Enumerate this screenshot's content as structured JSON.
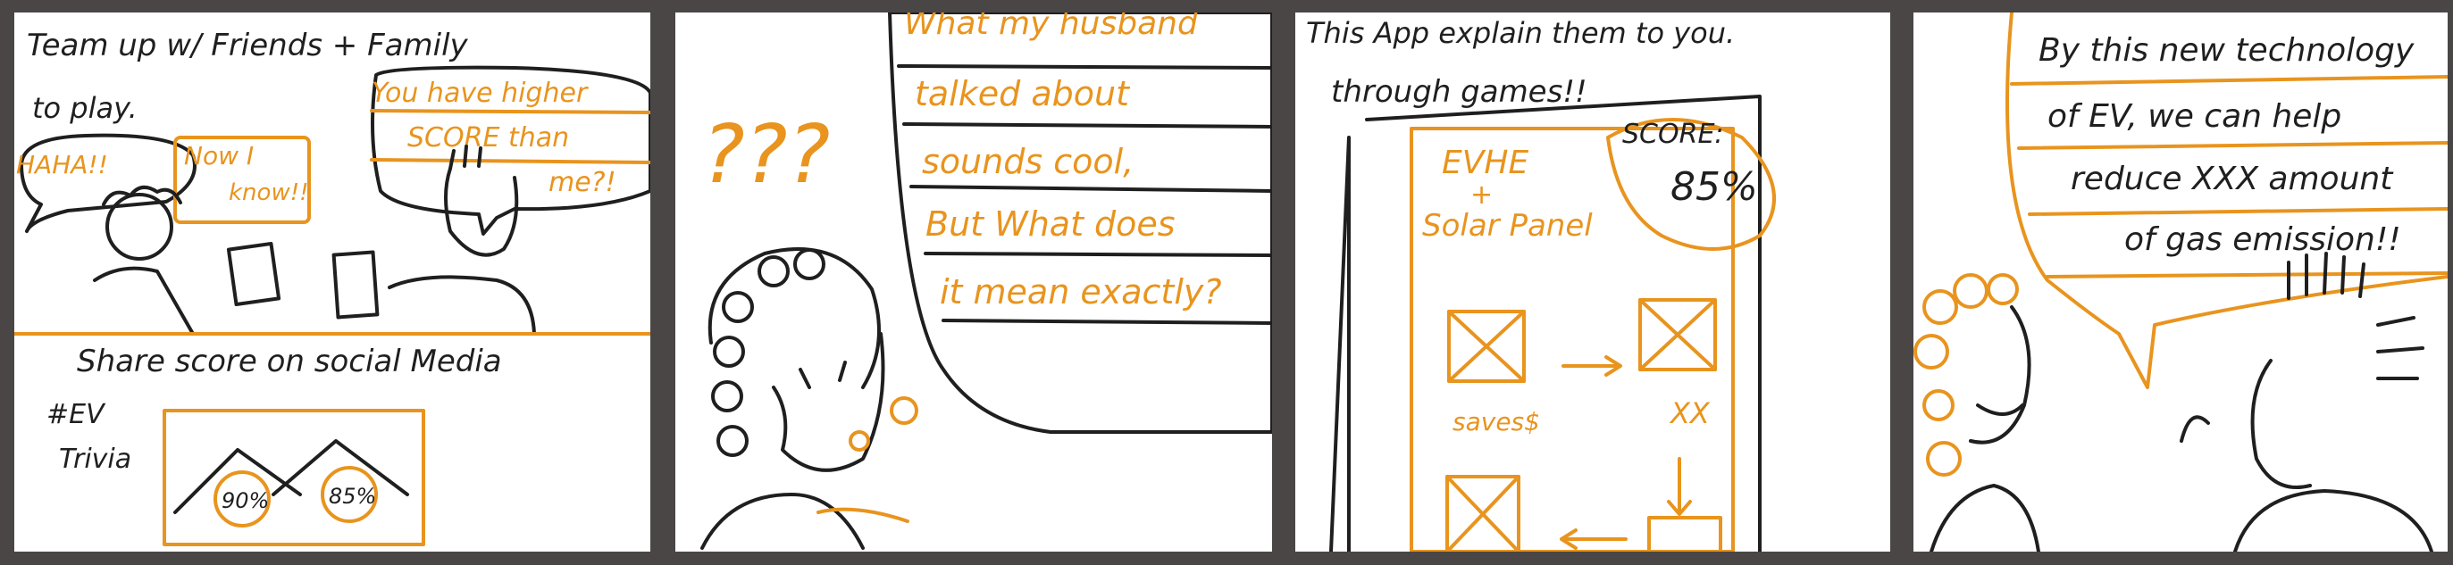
{
  "colors": {
    "ink": "#1f1f1f",
    "accent": "#e8941e",
    "gutter": "#4a4646",
    "paper": "#ffffff"
  },
  "panel1": {
    "caption_line1": "Team up w/ Friends + Family",
    "caption_line2": "to play.",
    "bubble_left_1": "HAHA!!",
    "bubble_left_2": "Now I",
    "bubble_left_3": "know!!",
    "bubble_right_1": "You have higher",
    "bubble_right_2": "SCORE than",
    "bubble_right_3": "me?!",
    "share_caption": "Share score on social Media",
    "hashtag_1": "#EV",
    "hashtag_2": "Trivia",
    "score_a": "90%",
    "score_b": "85%"
  },
  "panel2": {
    "question_marks": "???",
    "bubble_line_1": "What my husband",
    "bubble_line_2": "talked about",
    "bubble_line_3": "sounds cool,",
    "bubble_line_4": "But What does",
    "bubble_line_5": "it mean exactly?"
  },
  "panel3": {
    "caption_line1": "This App explain them to you.",
    "caption_line2": "through games!!",
    "app_title_1": "EVHE",
    "app_title_2": "+",
    "app_title_3": "Solar Panel",
    "score_label": "SCORE:",
    "score_value": "85%",
    "saves_label": "saves$",
    "xx_label": "XX"
  },
  "panel4": {
    "bubble_line_1": "By this new technology",
    "bubble_line_2": "of EV, we can help",
    "bubble_line_3": "reduce XXX amount",
    "bubble_line_4": "of gas emission!!"
  }
}
